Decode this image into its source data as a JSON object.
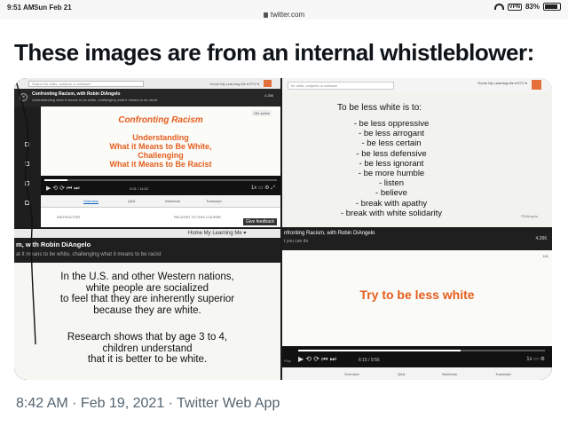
{
  "status_bar": {
    "time": "9:51 AM",
    "date": "Sun Feb 21",
    "url": "twitter.com",
    "vpn": "VPN",
    "battery": "83%"
  },
  "tweet": {
    "text": "These images are from an internal whistleblower:",
    "footer": "8:42 AM · Feb 19, 2021 · Twitter Web App"
  },
  "images": {
    "q1": {
      "search_placeholder": "Search for skills, subjects or software",
      "mini_nav": "Home   My Learning   Me ▾   ETV ▾",
      "course_title": "Confronting Racism, with Robin DiAngelo",
      "course_subtitle": "Understanding what it means to be white, challenging what it means to be racist",
      "likes": "4,286",
      "active_count": "181 active",
      "slide_heading": "Confronting Racism",
      "slide_lines": [
        "Understanding",
        "What it Means to Be White,",
        "Challenging",
        "What it Means to Be Racist"
      ],
      "progress": 0.1,
      "time": "0:01 / 11:02",
      "speed": "1x",
      "tabs": [
        "Overview",
        "Q&A",
        "Notebook",
        "Transcript"
      ],
      "instructor_label": "INSTRUCTOR",
      "related_label": "RELATED TO THIS COURSE",
      "feedback": "Give feedback"
    },
    "q2": {
      "search_placeholder": "for skills, subjects or software",
      "nav": "Home   My Learning   Me ▾   ETV ▾",
      "title": "To be less white is to:",
      "list": [
        "- be less oppressive",
        "- be less arrogant",
        "- be less certain",
        "- be less defensive",
        "- be less ignorant",
        "- be more humble",
        "- listen",
        "- believe",
        "- break with apathy",
        "- break with white solidarity"
      ],
      "logo": "©DiAngelo"
    },
    "q3": {
      "nav": "Home   My Learning   Me ▾",
      "title": "m, with Robin DiAngelo",
      "subtitle": "at it means to be white, challenging what it means to be racist",
      "para1": [
        "In the U.S. and other Western nations,",
        "white people are socialized",
        "to feel that they are inherently superior",
        "because they are white."
      ],
      "para2": [
        "Research shows that by age 3 to 4,",
        "children understand",
        "that it is better to be white."
      ]
    },
    "q4": {
      "title": "nfronting Racism, with Robin DiAngelo",
      "subtitle": "t you can do",
      "likes": "4,286",
      "active_count": "181",
      "big_text": "Try to be less white",
      "progress": 0.66,
      "time": "6:15 / 9:56",
      "speed": "1x",
      "play_tag": "Play",
      "tabs": [
        "Overview",
        "Q&A",
        "Notebook",
        "Transcript"
      ]
    }
  }
}
